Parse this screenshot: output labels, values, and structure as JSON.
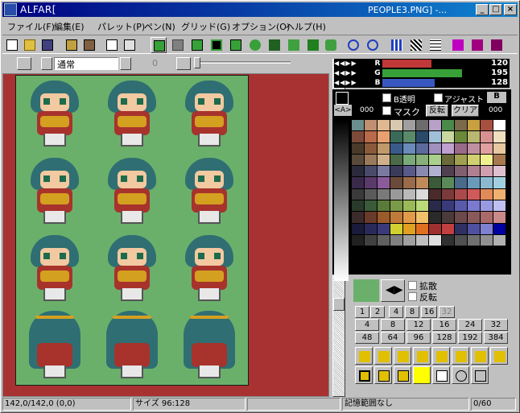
{
  "window": {
    "title_left": "ALFAR[",
    "title_right": "PEOPLE3.PNG] -..."
  },
  "caption_buttons": {
    "minimize": "_",
    "maximize": "□",
    "close": "×"
  },
  "menu": [
    "ファイル(F)",
    "編集(E)",
    "パレット(P)",
    "ペン(N)",
    "グリッド(G)",
    "オプション(O)",
    "ヘルプ(H)"
  ],
  "toolbar2": {
    "pen_mode": "通常",
    "size_value": "0"
  },
  "rgb": [
    {
      "label": "R",
      "value": "120",
      "color": "#c03838",
      "fraction": 0.47
    },
    {
      "label": "G",
      "value": "195",
      "color": "#38a038",
      "fraction": 0.76
    },
    {
      "label": "B",
      "value": "128",
      "color": "#3858c0",
      "fraction": 0.5
    }
  ],
  "palette_opts": {
    "a_label": "<A>",
    "a_value": "000",
    "b_transparent": "B透明",
    "adjust": "アジャスト",
    "mask": "マスク",
    "invert": "反転",
    "clear": "クリア",
    "b_label": "B",
    "b_value": "000"
  },
  "diffuse": {
    "spread": "拡散",
    "flip": "反転"
  },
  "zoom_values": [
    "1",
    "2",
    "4",
    "8",
    "16",
    "32",
    "4",
    "8",
    "12",
    "16",
    "24",
    "32",
    "48",
    "64",
    "96",
    "128",
    "192",
    "384"
  ],
  "status": {
    "coords": "142,0/142,0 (0,0)",
    "size": "サイズ 96:128",
    "memory": "記憶範囲なし",
    "count": "0/60"
  },
  "palette_colors": [
    "#6b8e8e",
    "#c09070",
    "#e0b890",
    "#d8c8b0",
    "#a0a0a0",
    "#6c6c6c",
    "#b8a0c8",
    "#4a8a4a",
    "#7a6a4a",
    "#c8a040",
    "#a85040",
    "#ffffff",
    "#7c4a3a",
    "#b86a4a",
    "#e8a070",
    "#3a6a5a",
    "#5a8a6a",
    "#2a4a6a",
    "#a0c0d8",
    "#c8d8a0",
    "#6a8a3a",
    "#b8b870",
    "#d89090",
    "#f0e0c0",
    "#4a3a2a",
    "#8a5a3a",
    "#c09a6a",
    "#3a5a8a",
    "#6a8aba",
    "#5a6a9a",
    "#a090c0",
    "#c0a0d0",
    "#9a6a8a",
    "#c090a0",
    "#e0a0a0",
    "#e8c8a0",
    "#5a4a3a",
    "#9a7a5a",
    "#d0b08a",
    "#4a6a4a",
    "#7aaa7a",
    "#8ab07a",
    "#aad08a",
    "#6a6a3a",
    "#a0a050",
    "#d0d070",
    "#f0f090",
    "#a87850",
    "#2a2a3a",
    "#4a4a6a",
    "#7a7aa0",
    "#3a3a5a",
    "#5a5a8a",
    "#8a8ab0",
    "#b0b0d0",
    "#504050",
    "#806070",
    "#b08090",
    "#d0a0b0",
    "#e0c0d0",
    "#3a2a4a",
    "#5a3a6a",
    "#8a5a9a",
    "#6a4a3a",
    "#9a6a4a",
    "#c08a5a",
    "#3a5a3a",
    "#5a8a5a",
    "#4a6a8a",
    "#6a9aba",
    "#8abad0",
    "#a0d0e0",
    "#3a3a3a",
    "#5a5a5a",
    "#7a7a7a",
    "#9a9a9a",
    "#bababa",
    "#dadada",
    "#4a2a2a",
    "#7a3a3a",
    "#aa4a4a",
    "#d05a5a",
    "#e08a5a",
    "#f0b070",
    "#2a3a2a",
    "#3a5a3a",
    "#5a7a3a",
    "#7a9a4a",
    "#9aba5a",
    "#bada7a",
    "#2a2a4a",
    "#3a3a7a",
    "#5a5aaa",
    "#7a7ad0",
    "#9a9ae0",
    "#c0c0f0",
    "#3a2a2a",
    "#6a3a2a",
    "#9a5a2a",
    "#c07a3a",
    "#e09a4a",
    "#f0c06a",
    "#2a2a2a",
    "#4a3a3a",
    "#6a4a4a",
    "#8a5a5a",
    "#aa6a6a",
    "#ca8a8a",
    "#1a1a3a",
    "#2a2a5a",
    "#3a3a7a",
    "#d0d030",
    "#e0a020",
    "#e07020",
    "#a03030",
    "#c04040",
    "#303060",
    "#5050a0",
    "#8080d0",
    "#0000a0",
    "#202020",
    "#404040",
    "#606060",
    "#808080",
    "#a0a0a0",
    "#c0c0c0",
    "#e0e0e0",
    "#303030",
    "#505050",
    "#707070",
    "#909090",
    "#b0b0b0"
  ]
}
